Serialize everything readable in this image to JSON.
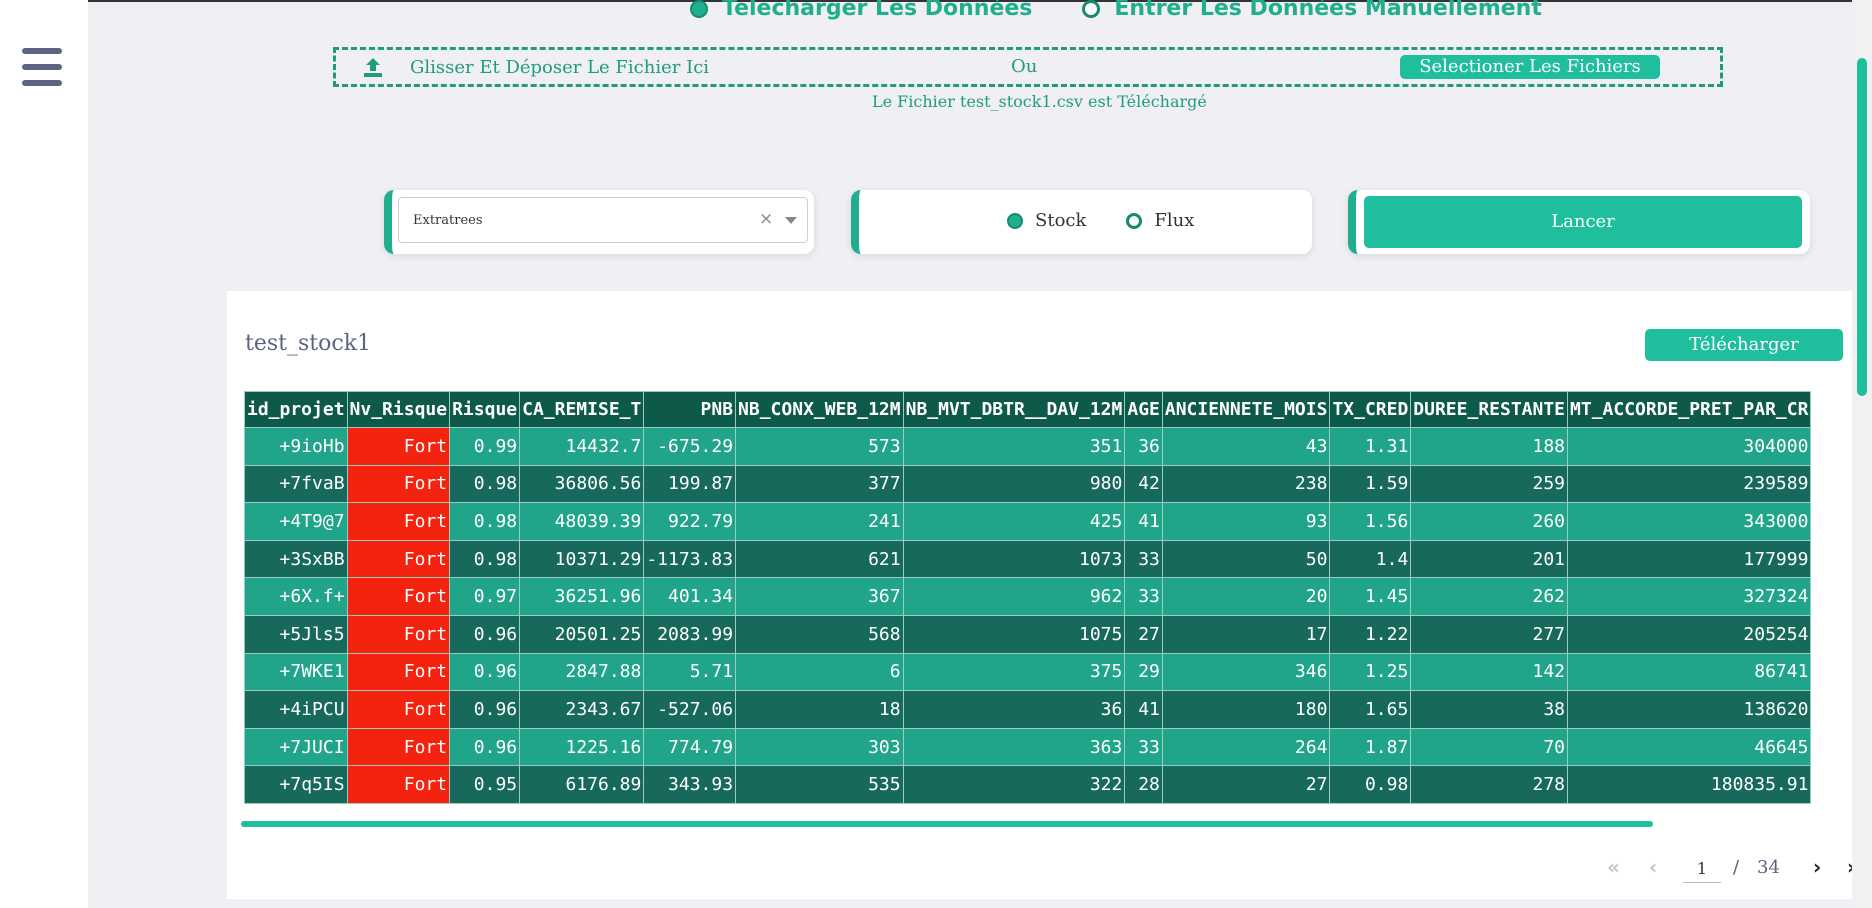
{
  "sidebar": {
    "menu_icon": "hamburger-menu-icon"
  },
  "mode": {
    "options": [
      {
        "label": "Telecharger Les Données",
        "selected": true
      },
      {
        "label": "Entrer Les Données Manuellement",
        "selected": false
      }
    ]
  },
  "upload": {
    "icon": "upload-icon",
    "drop_label": "Glisser Et Déposer Le Fichier Ici",
    "or_label": "Ou",
    "select_button": "Selectioner Les Fichiers",
    "status": "Le Fichier test_stock1.csv est Téléchargé"
  },
  "controls": {
    "dataset_select_value": "Extratrees",
    "clear_icon": "×",
    "type_options": [
      {
        "label": "Stock",
        "selected": true
      },
      {
        "label": "Flux",
        "selected": false
      }
    ],
    "run_button": "Lancer"
  },
  "results": {
    "title": "test_stock1",
    "download_button": "Télécharger",
    "columns": [
      "id_projet",
      "Nv_Risque",
      "Risque",
      "CA_REMISE_T",
      "PNB",
      "NB_CONX_WEB_12M",
      "NB_MVT_DBTR__DAV_12M",
      "AGE",
      "ANCIENNETE_MOIS",
      "TX_CRED",
      "DUREE_RESTANTE",
      "MT_ACCORDE_PRET_PAR_CR"
    ],
    "rows": [
      [
        "+9ioHb",
        "Fort",
        "0.99",
        "14432.7",
        "-675.29",
        "573",
        "351",
        "36",
        "43",
        "1.31",
        "188",
        "304000"
      ],
      [
        "+7fvaB",
        "Fort",
        "0.98",
        "36806.56",
        "199.87",
        "377",
        "980",
        "42",
        "238",
        "1.59",
        "259",
        "239589"
      ],
      [
        "+4T9@7",
        "Fort",
        "0.98",
        "48039.39",
        "922.79",
        "241",
        "425",
        "41",
        "93",
        "1.56",
        "260",
        "343000"
      ],
      [
        "+3SxBB",
        "Fort",
        "0.98",
        "10371.29",
        "-1173.83",
        "621",
        "1073",
        "33",
        "50",
        "1.4",
        "201",
        "177999"
      ],
      [
        "+6X.f+",
        "Fort",
        "0.97",
        "36251.96",
        "401.34",
        "367",
        "962",
        "33",
        "20",
        "1.45",
        "262",
        "327324"
      ],
      [
        "+5Jls5",
        "Fort",
        "0.96",
        "20501.25",
        "2083.99",
        "568",
        "1075",
        "27",
        "17",
        "1.22",
        "277",
        "205254"
      ],
      [
        "+7WKE1",
        "Fort",
        "0.96",
        "2847.88",
        "5.71",
        "6",
        "375",
        "29",
        "346",
        "1.25",
        "142",
        "86741"
      ],
      [
        "+4iPCU",
        "Fort",
        "0.96",
        "2343.67",
        "-527.06",
        "18",
        "36",
        "41",
        "180",
        "1.65",
        "38",
        "138620"
      ],
      [
        "+7JUCI",
        "Fort",
        "0.96",
        "1225.16",
        "774.79",
        "303",
        "363",
        "33",
        "264",
        "1.87",
        "70",
        "46645"
      ],
      [
        "+7q5IS",
        "Fort",
        "0.95",
        "6176.89",
        "343.93",
        "535",
        "322",
        "28",
        "27",
        "0.98",
        "278",
        "180835.91"
      ]
    ],
    "pagination": {
      "first": "«",
      "prev": "‹",
      "current_page": "1",
      "separator": "/",
      "total_pages": "34",
      "next": "›",
      "last": "»"
    }
  },
  "colors": {
    "accent": "#1fbe9c",
    "header_bg": "#0d5a4a",
    "row_light": "#21a58a",
    "row_dark": "#17695b",
    "risk_high": "#f4230f"
  }
}
